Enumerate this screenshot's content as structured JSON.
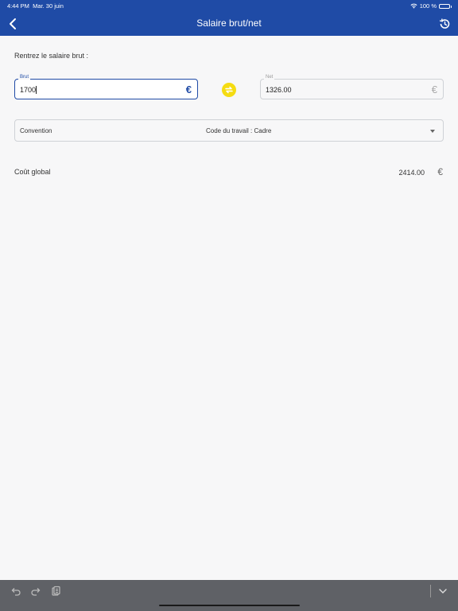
{
  "status_bar": {
    "time": "4:44 PM",
    "date": "Mar. 30 juin",
    "battery": "100 %"
  },
  "header": {
    "title": "Salaire brut/net"
  },
  "form": {
    "prompt": "Rentrez le salaire brut :",
    "brut": {
      "label": "Brut",
      "value": "1700",
      "currency": "€"
    },
    "net": {
      "label": "Net",
      "value": "1326.00",
      "currency": "€"
    },
    "convention": {
      "label": "Convention",
      "selected": "Code du travail : Cadre"
    }
  },
  "result": {
    "label": "Coût global",
    "value": "2414.00",
    "currency": "€"
  },
  "colors": {
    "header": "#1f4ba6",
    "accent_swap": "#f5dc12",
    "toolbar": "#5f6166"
  },
  "icons": {
    "back": "chevron-left-icon",
    "history": "history-icon",
    "swap": "swap-icon",
    "undo": "undo-icon",
    "redo": "redo-icon",
    "clipboard": "clipboard-icon",
    "keyboard_dismiss": "chevron-down-icon"
  }
}
